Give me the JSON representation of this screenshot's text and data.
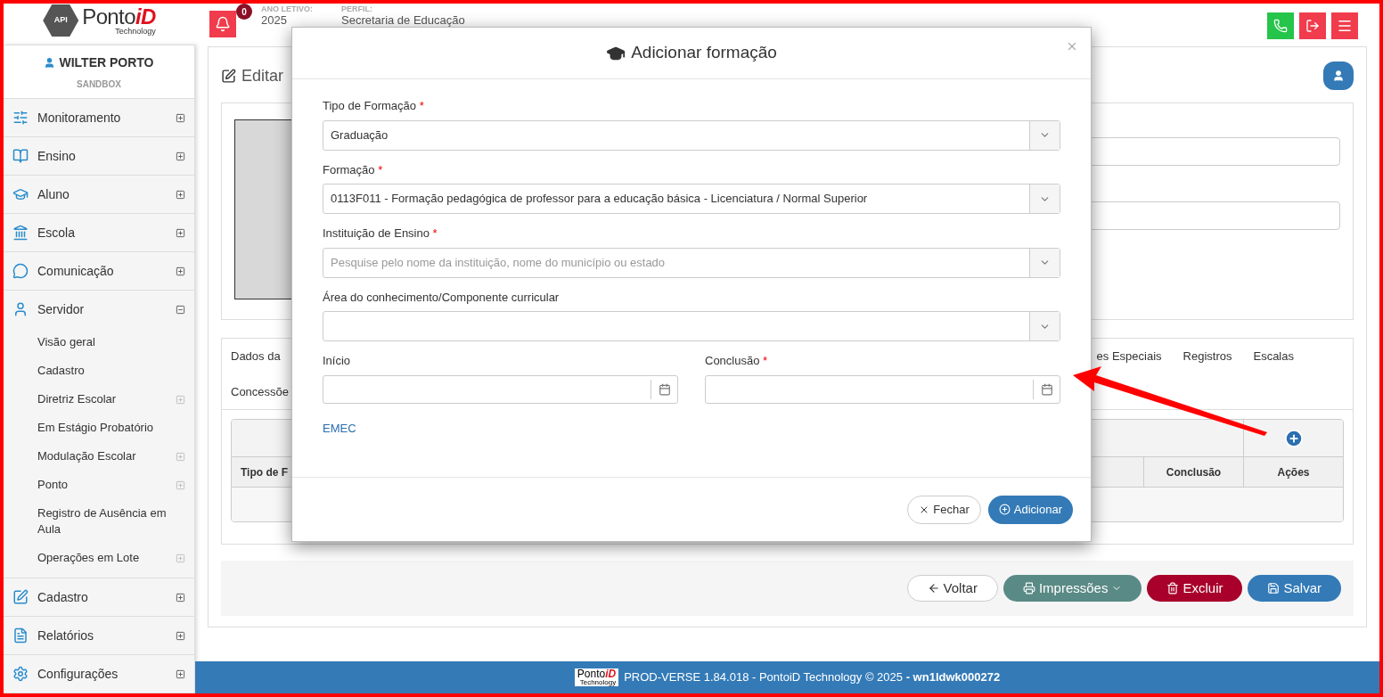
{
  "header": {
    "logo": {
      "badge": "API",
      "name": "Ponto",
      "accent": "iD",
      "sub": "Technology"
    },
    "notification_count": "0",
    "school_year_label": "ANO LETIVO:",
    "school_year": "2025",
    "profile_label": "PERFIL:",
    "profile": "Secretaria de Educação"
  },
  "sidebar": {
    "user": "WILTER PORTO",
    "environment": "SANDBOX",
    "items": [
      {
        "label": "Monitoramento",
        "expanded": false
      },
      {
        "label": "Ensino",
        "expanded": false
      },
      {
        "label": "Aluno",
        "expanded": false
      },
      {
        "label": "Escola",
        "expanded": false
      },
      {
        "label": "Comunicação",
        "expanded": false
      },
      {
        "label": "Servidor",
        "expanded": true,
        "children": [
          {
            "label": "Visão geral",
            "expandable": false
          },
          {
            "label": "Cadastro",
            "expandable": false
          },
          {
            "label": "Diretriz Escolar",
            "expandable": true
          },
          {
            "label": "Em Estágio Probatório",
            "expandable": false
          },
          {
            "label": "Modulação Escolar",
            "expandable": true
          },
          {
            "label": "Ponto",
            "expandable": true
          },
          {
            "label": "Registro de Ausência em Aula",
            "expandable": false
          },
          {
            "label": "Operações em Lote",
            "expandable": true
          }
        ]
      },
      {
        "label": "Cadastro",
        "expanded": false
      },
      {
        "label": "Relatórios",
        "expanded": false
      },
      {
        "label": "Configurações",
        "expanded": false
      }
    ]
  },
  "page": {
    "title": "Editar",
    "tabs_left": [
      "Dados da",
      "Concessõe"
    ],
    "tabs_right": [
      "es Especiais",
      "Registros",
      "Escalas"
    ],
    "table_columns": [
      "Tipo de F",
      "Conclusão",
      "Ações"
    ],
    "buttons": [
      {
        "label": "Voltar",
        "kind": "back"
      },
      {
        "label": "Impressões",
        "kind": "print"
      },
      {
        "label": "Excluir",
        "kind": "delete"
      },
      {
        "label": "Salvar",
        "kind": "save"
      }
    ]
  },
  "modal": {
    "title": "Adicionar formação",
    "fields": [
      {
        "label": "Tipo de Formação",
        "required": true,
        "value": "Graduação"
      },
      {
        "label": "Formação",
        "required": true,
        "value": "0113F011 - Formação pedagógica de professor para a educação básica - Licenciatura / Normal Superior"
      },
      {
        "label": "Instituição de Ensino",
        "required": true,
        "placeholder": "Pesquise pelo nome da instituição, nome do município ou estado"
      },
      {
        "label": "Área do conhecimento/Componente curricular",
        "required": false
      }
    ],
    "dates": [
      {
        "label": "Início",
        "required": false
      },
      {
        "label": "Conclusão",
        "required": true
      }
    ],
    "required_mark": "*",
    "link": "EMEC",
    "buttons": [
      {
        "label": "Fechar",
        "kind": "close"
      },
      {
        "label": "Adicionar",
        "kind": "add"
      }
    ]
  },
  "footer": {
    "logo": {
      "name": "Ponto",
      "accent": "iD",
      "sub": "Technology"
    },
    "text": "PROD-VERSE 1.84.018 - PontoiD Technology © 2025 **- wn1ldwk000272**"
  }
}
